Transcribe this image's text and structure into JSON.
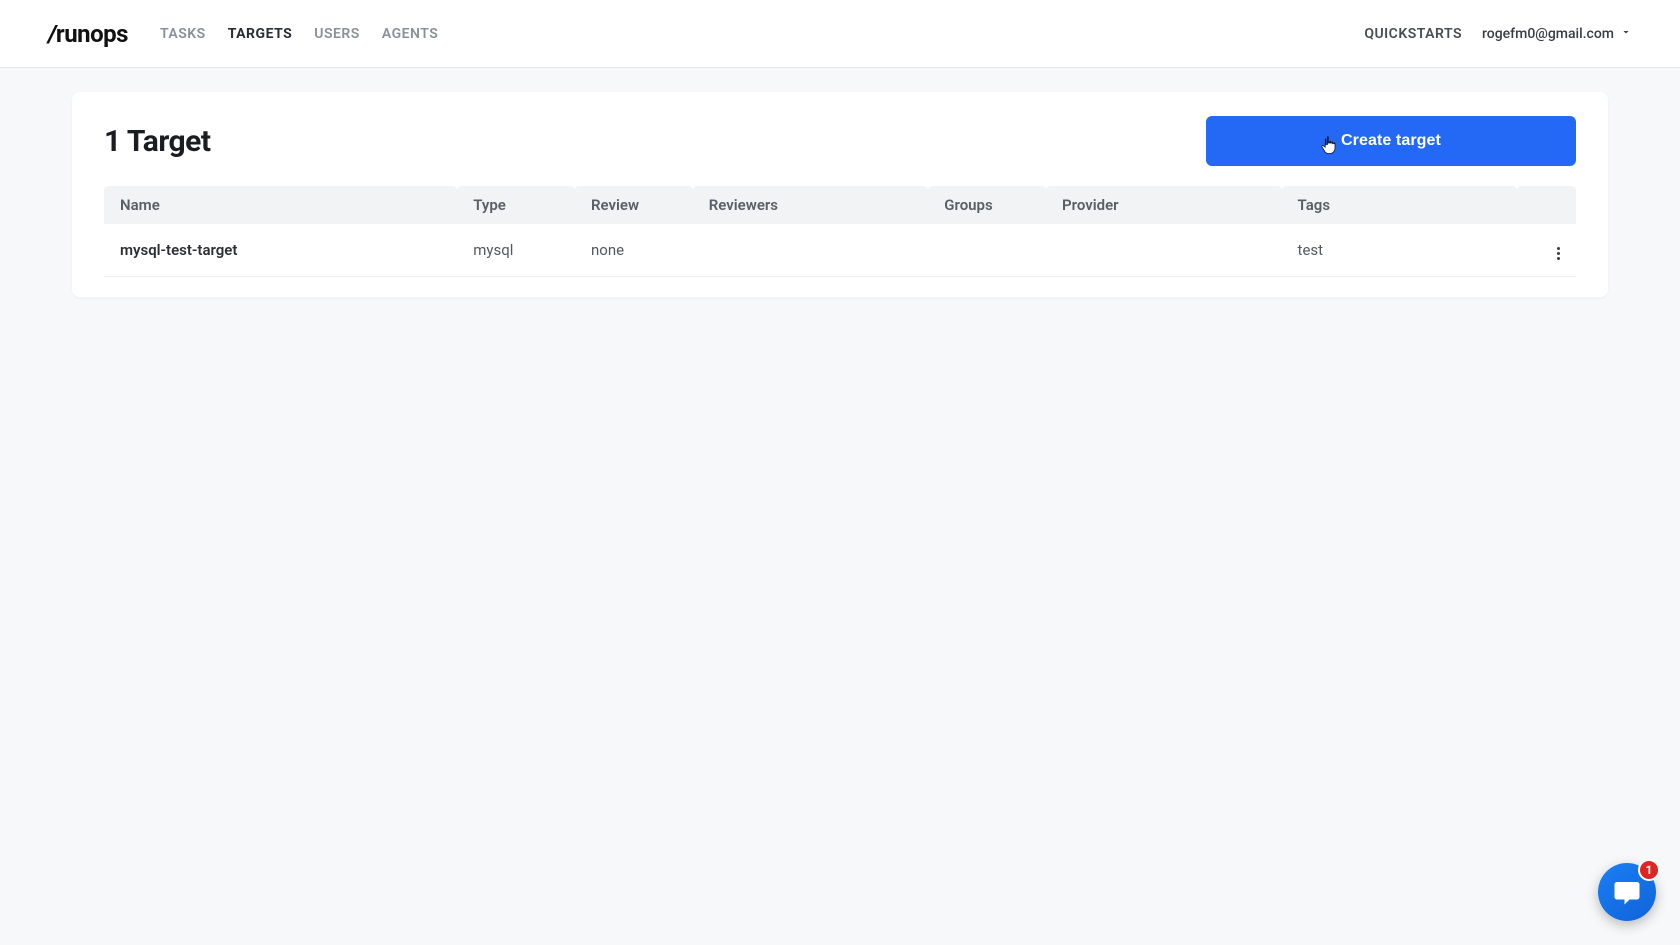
{
  "brand": {
    "prefix": "/",
    "name": "runops"
  },
  "nav": {
    "tasks": "TASKS",
    "targets": "TARGETS",
    "users": "USERS",
    "agents": "AGENTS"
  },
  "header": {
    "quickstarts": "QUICKSTARTS",
    "user_email": "rogefm0@gmail.com"
  },
  "page": {
    "title": "1 Target",
    "create_button": "Create target"
  },
  "table": {
    "columns": {
      "name": "Name",
      "type": "Type",
      "review": "Review",
      "reviewers": "Reviewers",
      "groups": "Groups",
      "provider": "Provider",
      "tags": "Tags"
    },
    "rows": [
      {
        "name": "mysql-test-target",
        "type": "mysql",
        "review": "none",
        "reviewers": "",
        "groups": "",
        "provider": "",
        "tags": "test"
      }
    ]
  },
  "chat": {
    "badge_count": "1"
  }
}
